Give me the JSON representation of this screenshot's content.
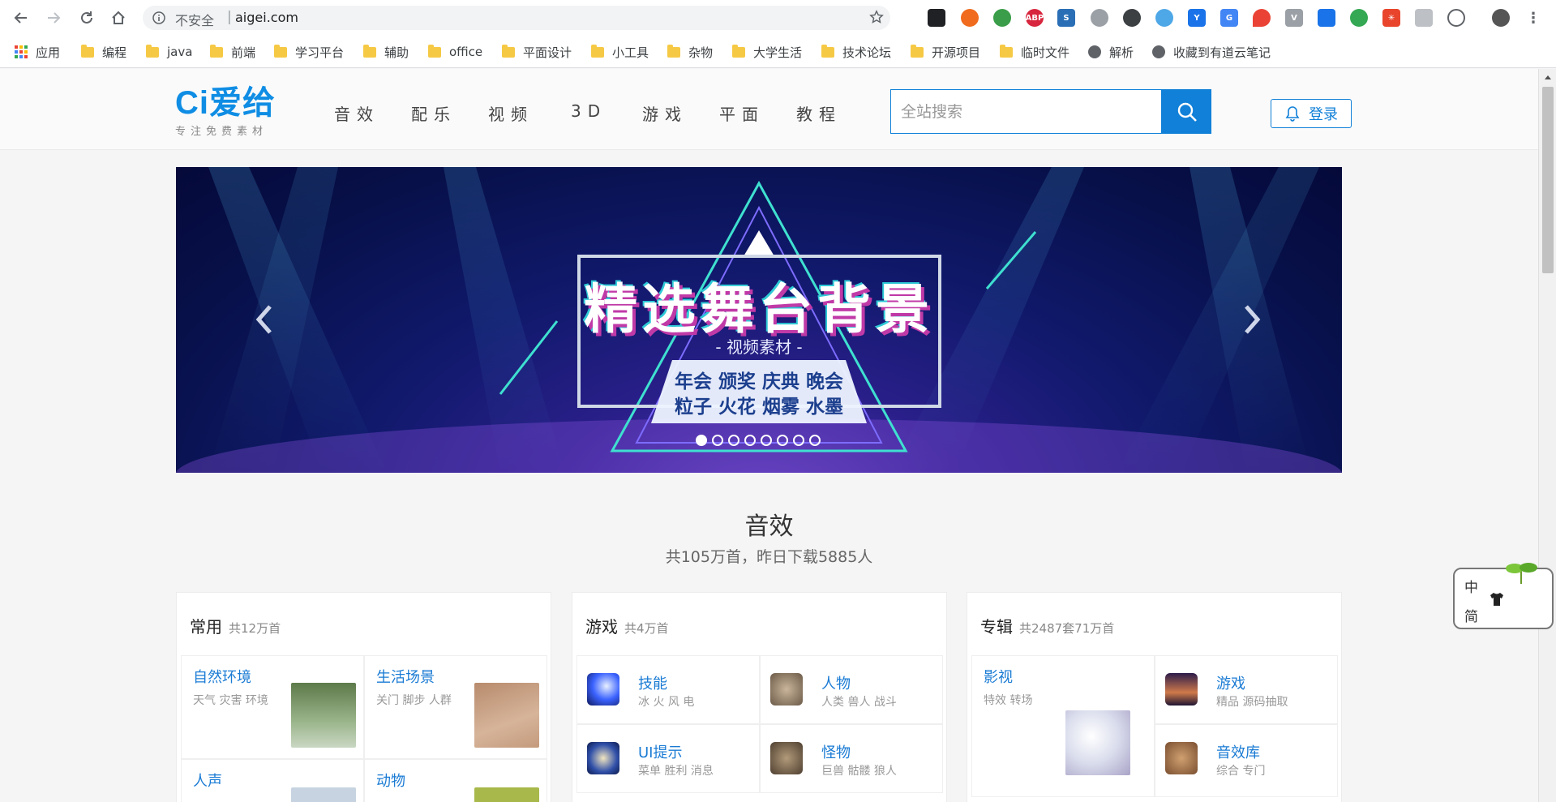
{
  "browser": {
    "secure_label": "不安全",
    "separator": "|",
    "url": "aigei.com"
  },
  "bookmarks": [
    {
      "label": "应用",
      "icon": "apps-grid-icon"
    },
    {
      "label": "编程",
      "icon": "folder-icon"
    },
    {
      "label": "java",
      "icon": "folder-icon"
    },
    {
      "label": "前端",
      "icon": "folder-icon"
    },
    {
      "label": "学习平台",
      "icon": "folder-icon"
    },
    {
      "label": "辅助",
      "icon": "folder-icon"
    },
    {
      "label": "office",
      "icon": "folder-icon"
    },
    {
      "label": "平面设计",
      "icon": "folder-icon"
    },
    {
      "label": "小工具",
      "icon": "folder-icon"
    },
    {
      "label": "杂物",
      "icon": "folder-icon"
    },
    {
      "label": "大学生活",
      "icon": "folder-icon"
    },
    {
      "label": "技术论坛",
      "icon": "folder-icon"
    },
    {
      "label": "开源项目",
      "icon": "folder-icon"
    },
    {
      "label": "临时文件",
      "icon": "folder-icon"
    },
    {
      "label": "解析",
      "icon": "globe-icon"
    },
    {
      "label": "收藏到有道云笔记",
      "icon": "globe-icon"
    }
  ],
  "site": {
    "logo_text": "Ci爱给",
    "logo_sub": "专注免费素材",
    "nav": [
      "音效",
      "配乐",
      "视频",
      "3D",
      "游戏",
      "平面",
      "教程"
    ],
    "search_placeholder": "全站搜索",
    "login_label": "登录",
    "brand_color": "#1080d8"
  },
  "banner": {
    "title": "精选舞台背景",
    "subtitle": "- 视频素材 -",
    "tags_line1": "年会 颁奖 庆典 晚会",
    "tags_line2": "粒子 火花 烟雾 水墨",
    "slide_count": 8,
    "active_slide": 1
  },
  "section": {
    "title": "音效",
    "subtitle": "共105万首，昨日下载5885人"
  },
  "cards": [
    {
      "name": "常用",
      "count": "共12万首",
      "items": [
        {
          "title": "自然环境",
          "tags": "天气 灾害 环境"
        },
        {
          "title": "生活场景",
          "tags": "关门 脚步 人群"
        },
        {
          "title": "人声",
          "tags": ""
        },
        {
          "title": "动物",
          "tags": ""
        }
      ]
    },
    {
      "name": "游戏",
      "count": "共4万首",
      "items": [
        {
          "title": "技能",
          "tags": "冰 火 风 电"
        },
        {
          "title": "人物",
          "tags": "人类 兽人 战斗"
        },
        {
          "title": "UI提示",
          "tags": "菜单 胜利 消息"
        },
        {
          "title": "怪物",
          "tags": "巨兽 骷髅 狼人"
        }
      ]
    },
    {
      "name": "专辑",
      "count": "共2487套71万首",
      "items": [
        {
          "title": "影视",
          "tags": "特效 转场"
        },
        {
          "title": "游戏",
          "tags": "精品 源码抽取"
        },
        {
          "title": "音效库",
          "tags": "综合 专门"
        }
      ]
    }
  ],
  "ime": {
    "line1": "中",
    "line2": "简"
  }
}
